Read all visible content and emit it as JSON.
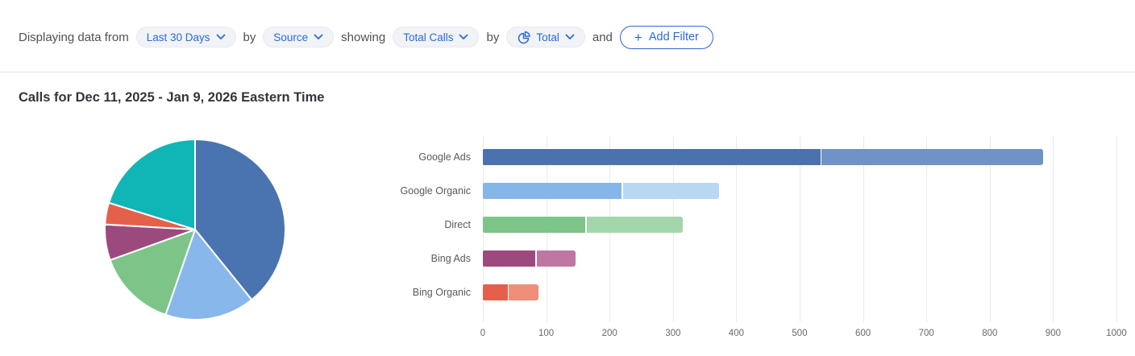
{
  "filter_bar": {
    "items": [
      {
        "type": "text",
        "text": "Displaying data from"
      },
      {
        "type": "dropdown",
        "name": "date-range-dropdown",
        "label": "Last 30 Days"
      },
      {
        "type": "text",
        "text": "by"
      },
      {
        "type": "dropdown",
        "name": "group-by-dropdown",
        "label": "Source"
      },
      {
        "type": "text",
        "text": "showing"
      },
      {
        "type": "dropdown",
        "name": "metric-dropdown",
        "label": "Total Calls"
      },
      {
        "type": "text",
        "text": "by"
      },
      {
        "type": "dropdown",
        "name": "time-grouping-dropdown",
        "label": "Total",
        "icon": "pie-chart-icon"
      },
      {
        "type": "text",
        "text": "and"
      },
      {
        "type": "button",
        "name": "add-filter-button",
        "plus": "+",
        "label": "Add Filter"
      }
    ],
    "accent_color": "#2a6bd2"
  },
  "title": "Calls for Dec 11, 2025 - Jan 9, 2026 Eastern Time",
  "chart_data": [
    {
      "type": "pie",
      "start_angle_deg": 0,
      "direction": "clockwise",
      "slices": [
        {
          "color": "#4a74b0",
          "percent": 39.2
        },
        {
          "color": "#88b7ec",
          "percent": 16.1
        },
        {
          "color": "#7cc488",
          "percent": 14.2
        },
        {
          "color": "#9c4a7e",
          "percent": 6.4
        },
        {
          "color": "#e5604b",
          "percent": 3.9
        },
        {
          "color": "#10b5b5",
          "percent": 20.2
        }
      ]
    },
    {
      "type": "bar",
      "orientation": "horizontal",
      "stacked": true,
      "categories": [
        "Google Ads",
        "Google Organic",
        "Direct",
        "Bing Ads",
        "Bing Organic"
      ],
      "series": [
        {
          "name": "segment_1",
          "values": [
            533,
            219,
            162,
            83,
            39
          ],
          "colors": [
            "#4a72ad",
            "#85b6ea",
            "#7cc488",
            "#9c4a7e",
            "#e5604b"
          ]
        },
        {
          "name": "segment_2",
          "values": [
            350,
            152,
            152,
            62,
            47
          ],
          "colors": [
            "#6e93c4",
            "#b8d7f3",
            "#a2d6ab",
            "#bd77a2",
            "#f08f79"
          ]
        }
      ],
      "x_ticks": [
        0,
        100,
        200,
        300,
        400,
        500,
        600,
        700,
        800,
        900,
        1000
      ],
      "xlim": [
        0,
        1000
      ],
      "grid": true,
      "grid_color": "#e8eaec"
    }
  ]
}
